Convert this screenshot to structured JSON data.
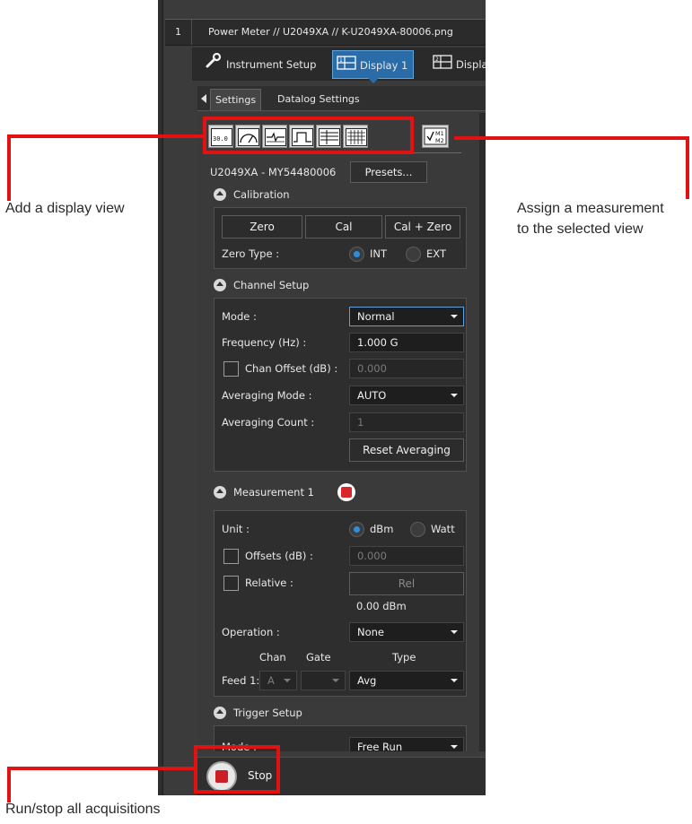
{
  "window": {
    "tab_number": "1",
    "tab_title": "Power Meter // U2049XA // K-U2049XA-80006.png"
  },
  "mode_tabs": [
    {
      "label": "Instrument Setup",
      "icon": "wrench-icon"
    },
    {
      "label": "Display 1",
      "icon": "display-1-icon",
      "active": true
    },
    {
      "label": "Displa",
      "icon": "display-2-icon"
    }
  ],
  "sub_tabs": [
    {
      "label": "Settings",
      "active": true
    },
    {
      "label": "Datalog Settings"
    }
  ],
  "view_toolbar": {
    "icons": [
      "numeric-view-icon",
      "analog-meter-view-icon",
      "trace-view-icon",
      "pulse-view-icon",
      "table-view-icon",
      "grid-view-icon"
    ],
    "numeric_icon_text": "30.0 dB",
    "assign_icon": "assign-measurement-icon",
    "assign_icon_text_top": "M1",
    "assign_icon_text_bottom": "M2"
  },
  "device": {
    "name": "U2049XA - MY54480006",
    "presets_label": "Presets..."
  },
  "calibration": {
    "header": "Calibration",
    "zero_label": "Zero",
    "cal_label": "Cal",
    "cal_zero_label": "Cal + Zero",
    "zero_type_label": "Zero Type :",
    "options": [
      "INT",
      "EXT"
    ],
    "selected": "INT"
  },
  "channel_setup": {
    "header": "Channel Setup",
    "mode_label": "Mode :",
    "mode_value": "Normal",
    "frequency_label": "Frequency (Hz) :",
    "frequency_value": "1.000 G",
    "chan_offset_label": "Chan Offset (dB) :",
    "chan_offset_value": "0.000",
    "averaging_mode_label": "Averaging Mode :",
    "averaging_mode_value": "AUTO",
    "averaging_count_label": "Averaging Count :",
    "averaging_count_value": "1",
    "reset_averaging_label": "Reset Averaging"
  },
  "measurement": {
    "header": "Measurement 1",
    "unit_label": "Unit :",
    "unit_options": [
      "dBm",
      "Watt"
    ],
    "unit_selected": "dBm",
    "offsets_label": "Offsets (dB) :",
    "offsets_value": "0.000",
    "relative_label": "Relative :",
    "rel_button_label": "Rel",
    "rel_value": "0.00 dBm",
    "operation_label": "Operation :",
    "operation_value": "None",
    "col_chan": "Chan",
    "col_gate": "Gate",
    "col_type": "Type",
    "feed_label": "Feed 1:",
    "feed_chan": "A",
    "feed_gate": "",
    "feed_type": "Avg"
  },
  "trigger_setup": {
    "header": "Trigger Setup",
    "mode_label": "Mode :",
    "mode_value": "Free Run"
  },
  "run_control": {
    "label": "Stop"
  },
  "annotations": {
    "add_view": "Add a display view",
    "assign_line1": "Assign a measurement",
    "assign_line2": "to the selected view",
    "run_stop": "Run/stop all acquisitions",
    "highlight_color": "#e21212"
  }
}
